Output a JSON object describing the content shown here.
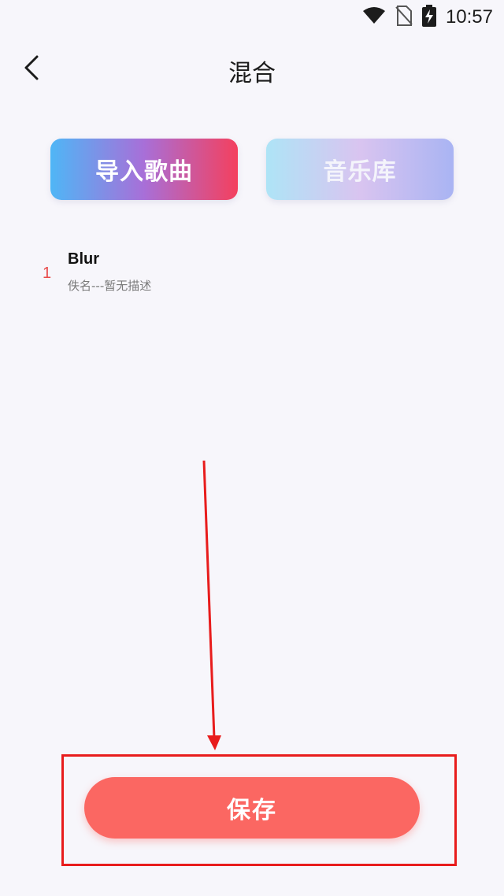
{
  "status_bar": {
    "time": "10:57",
    "icons": [
      "wifi-icon",
      "no-sim-icon",
      "battery-charging-icon"
    ]
  },
  "header": {
    "back_icon": "chevron-left-icon",
    "title": "混合"
  },
  "actions": {
    "import_label": "导入歌曲",
    "library_label": "音乐库"
  },
  "songs": [
    {
      "index": "1",
      "title": "Blur",
      "subtitle": "佚名---暂无描述"
    }
  ],
  "footer": {
    "save_label": "保存"
  },
  "colors": {
    "accent": "#fb6762",
    "annotation": "#e81c1c",
    "index": "#e84a4a"
  }
}
